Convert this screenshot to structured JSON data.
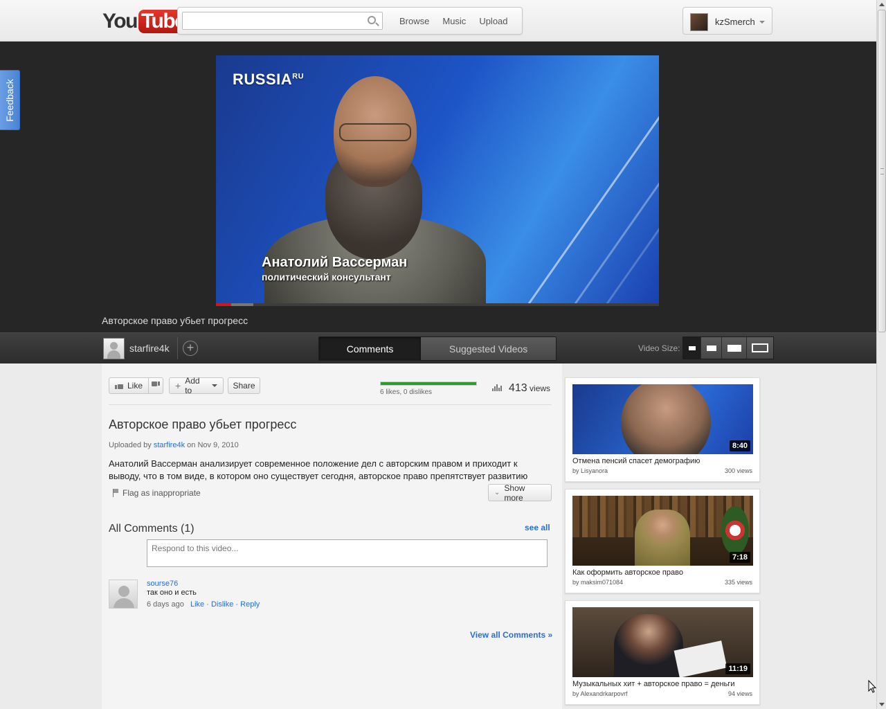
{
  "header": {
    "logo_you": "You",
    "logo_tube": "Tube",
    "search_placeholder": "",
    "nav": [
      "Browse",
      "Music",
      "Upload"
    ],
    "username": "kzSmerch"
  },
  "feedback_label": "Feedback",
  "video": {
    "channel_logo": "RUSSIA",
    "channel_logo_sup": "RU",
    "caption_name": "Анатолий Вассерман",
    "caption_role": "политический консультант",
    "title": "Авторское право убьет прогресс",
    "progress_played_fraction": 0.034,
    "progress_loaded_fraction": 0.084
  },
  "info_bar": {
    "uploader": "starfire4k",
    "tabs": [
      "Comments",
      "Suggested Videos"
    ],
    "active_tab": "Comments",
    "video_size_label": "Video Size:"
  },
  "actions": {
    "like_label": "Like",
    "add_to_label": "Add to",
    "share_label": "Share",
    "rating_text": "6 likes, 0 dislikes",
    "likes": 6,
    "dislikes": 0,
    "views_number": "413",
    "views_label": "views"
  },
  "details": {
    "title": "Авторское право убьет прогресс",
    "uploaded_prefix": "Uploaded by",
    "uploader": "starfire4k",
    "uploaded_on": "on Nov 9, 2010",
    "description": "Анатолий Вассерман анализирует современное положение дел с авторским правом и приходит к выводу, что в том виде, в котором оно существует сегодня, авторское право препятствует развитию",
    "flag_label": "Flag as inappropriate",
    "show_more_label": "Show more"
  },
  "comments": {
    "heading": "All Comments (1)",
    "see_all": "see all",
    "respond_placeholder": "Respond to this video...",
    "items": [
      {
        "author": "sourse76",
        "text": "так оно и есть",
        "age": "6 days ago",
        "like": "Like",
        "dislike": "Dislike",
        "reply": "Reply"
      }
    ],
    "view_all": "View all Comments »"
  },
  "related": [
    {
      "title": "Отмена пенсий спасет демографию",
      "by": "by Lisyanora",
      "views": "300 views",
      "duration": "8:40"
    },
    {
      "title": "Как оформить авторское право",
      "by": "by maksim071084",
      "views": "335 views",
      "duration": "7:18"
    },
    {
      "title": "Музыкальных хит + авторское право = деньги",
      "by": "by Alexandrkarpovrf",
      "views": "94 views",
      "duration": "11:19"
    }
  ],
  "colors": {
    "accent_link": "#2a6ed2",
    "progress_red": "#cc181e",
    "rating_green": "#2d9b2d",
    "feedback_blue": "#4a84d4"
  }
}
